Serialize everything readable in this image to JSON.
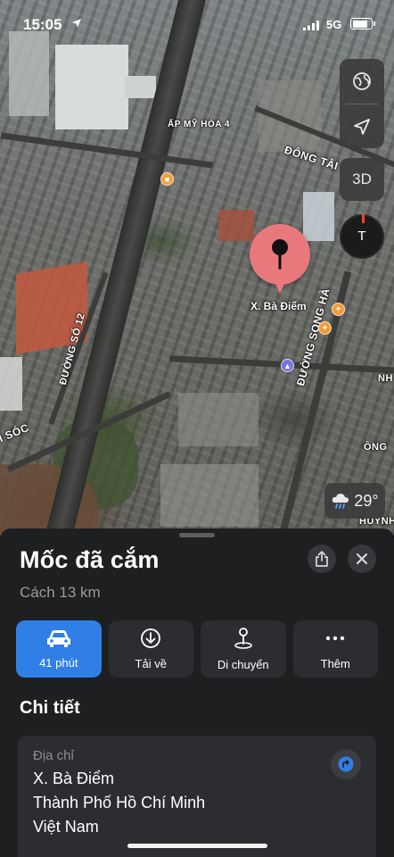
{
  "status_bar": {
    "time": "15:05",
    "network": "5G"
  },
  "map": {
    "labels": {
      "ap_my_hoa": "ẤP MỸ HÒA 4",
      "dong_tai": "ĐÔNG TÂI",
      "duong_so_12": "ĐƯỜNG SỐ 12",
      "duong_song_hanh": "ĐƯỜNG SONG HÀ",
      "hoc_mon": "I SÓC",
      "huynh": "HUỲNH",
      "ong": "ÔNG",
      "nh": "NH"
    },
    "controls": {
      "three_d_label": "3D",
      "compass_label": "T"
    },
    "pin_label": "X. Bà Điểm",
    "weather": {
      "temperature": "29°",
      "icon": "cloud-rain-icon"
    }
  },
  "sheet": {
    "title": "Mốc đã cắm",
    "distance": "Cách 13 km",
    "actions": [
      {
        "label": "41 phút",
        "icon": "car-icon"
      },
      {
        "label": "Tải về",
        "icon": "download-icon"
      },
      {
        "label": "Di chuyển",
        "icon": "move-pin-icon"
      },
      {
        "label": "Thêm",
        "icon": "more-icon"
      }
    ],
    "details_heading": "Chi tiết",
    "address": {
      "caption": "Địa chỉ",
      "line1": "X. Bà Điểm",
      "line2": "Thành Phố Hồ Chí Minh",
      "line3": "Việt Nam"
    }
  },
  "colors": {
    "accent": "#2f7fe6",
    "pin": "#e8787c",
    "sheet_bg": "#1e1f21",
    "card_bg": "#2c2d30"
  }
}
